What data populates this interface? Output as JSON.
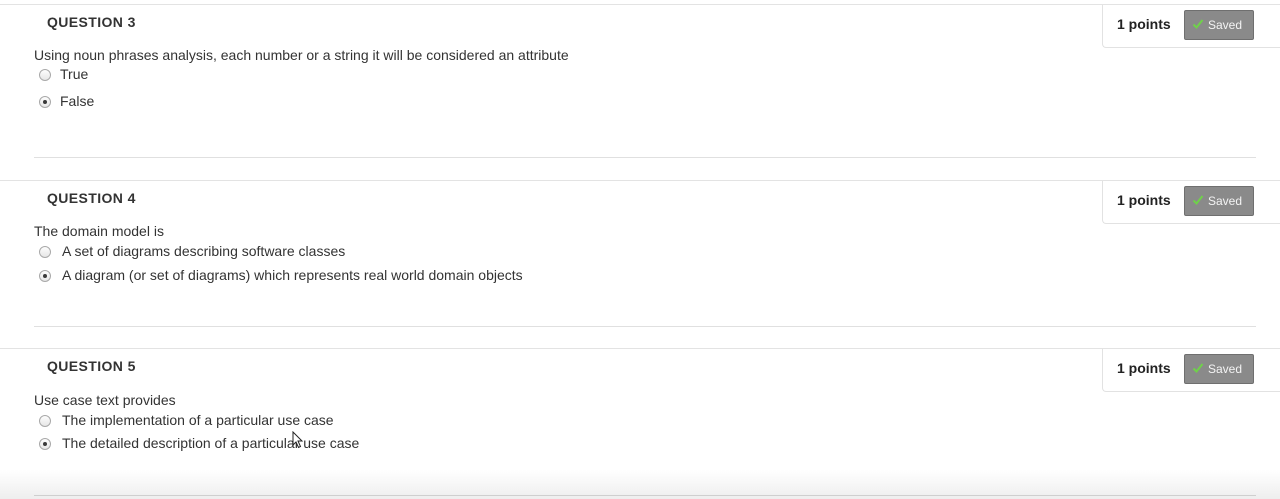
{
  "questions": [
    {
      "title": "QUESTION 3",
      "points": "1 points",
      "status": "Saved",
      "text": "Using noun phrases analysis, each number or a string it will be considered an attribute",
      "options": [
        {
          "label": "True",
          "selected": false
        },
        {
          "label": "False",
          "selected": true
        }
      ]
    },
    {
      "title": "QUESTION 4",
      "points": "1 points",
      "status": "Saved",
      "text": "The domain model is",
      "options": [
        {
          "label": "A set of diagrams describing software classes",
          "selected": false
        },
        {
          "label": "A diagram (or set of diagrams) which represents real world domain objects",
          "selected": true
        }
      ]
    },
    {
      "title": "QUESTION 5",
      "points": "1 points",
      "status": "Saved",
      "text": "Use case text provides",
      "options": [
        {
          "label": "The implementation of a particular use case",
          "selected": false
        },
        {
          "label": "The detailed description of a particular use case",
          "selected": true
        }
      ]
    }
  ],
  "colors": {
    "saved_badge_bg": "#8a8a8a",
    "check_green": "#6fd14a",
    "divider": "#e0e0e0"
  },
  "icons": {
    "saved": "checkmark-icon",
    "cursor": "mouse-pointer-icon"
  }
}
